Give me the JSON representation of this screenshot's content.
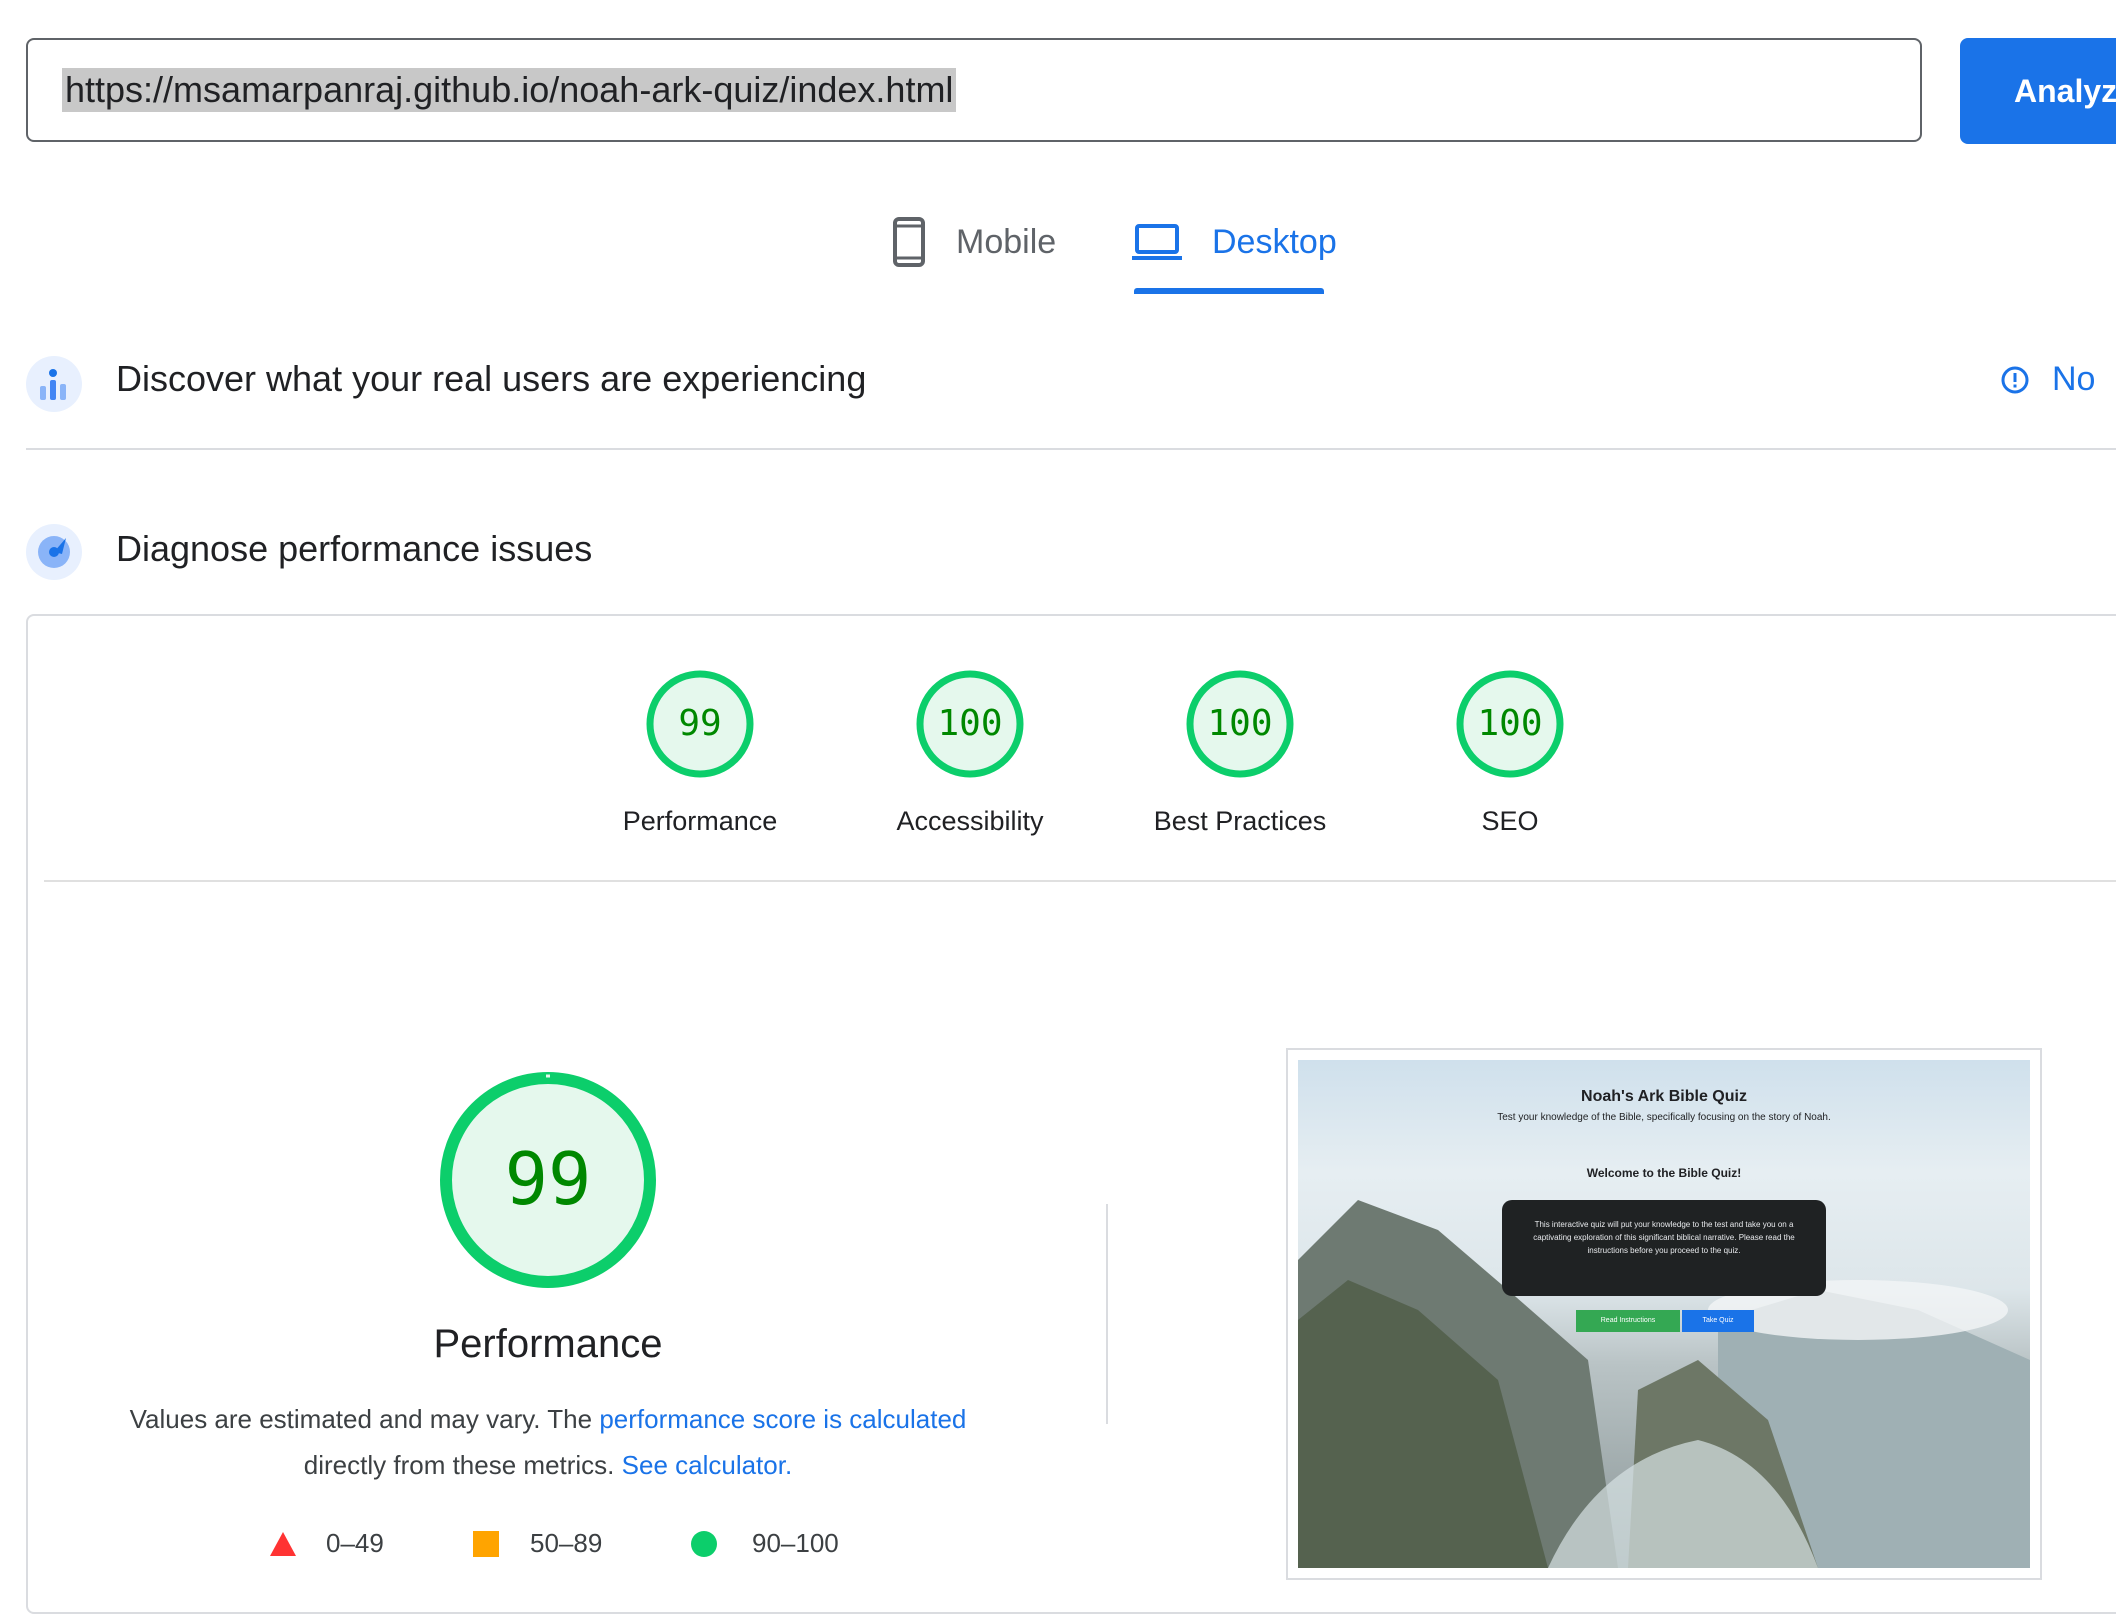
{
  "url_bar": {
    "value": "https://msamarpanraj.github.io/noah-ark-quiz/index.html",
    "analyze_label": "Analyze"
  },
  "device_tabs": {
    "mobile_label": "Mobile",
    "desktop_label": "Desktop",
    "selected": "Desktop"
  },
  "crux": {
    "title": "Discover what your real users are experiencing",
    "info_link": "No"
  },
  "diagnose": {
    "title": "Diagnose performance issues"
  },
  "categories": [
    {
      "label": "Performance",
      "score": "99"
    },
    {
      "label": "Accessibility",
      "score": "100"
    },
    {
      "label": "Best Practices",
      "score": "100"
    },
    {
      "label": "SEO",
      "score": "100"
    }
  ],
  "performance_detail": {
    "score": "99",
    "title": "Performance",
    "desc_prefix": "Values are estimated and may vary. The ",
    "desc_link1": "performance score is calculated",
    "desc_middle": " directly from these metrics. ",
    "desc_link2": "See calculator."
  },
  "legend": [
    {
      "range": "0–49",
      "shape": "triangle",
      "color": "#ff3333"
    },
    {
      "range": "50–89",
      "shape": "square",
      "color": "#ffa400"
    },
    {
      "range": "90–100",
      "shape": "circle",
      "color": "#0cce6b"
    }
  ],
  "screenshot": {
    "title": "Noah's Ark Bible Quiz",
    "subtitle": "Test your knowledge of the Bible, specifically focusing on the story of Noah.",
    "welcome": "Welcome to the Bible Quiz!",
    "body": "This interactive quiz will put your knowledge to the test and take you on a captivating exploration of this significant biblical narrative. Please read the instructions before you proceed to the quiz.",
    "button1": "Read Instructions",
    "button2": "Take Quiz"
  },
  "colors": {
    "accent": "#1a73e8",
    "pass": "#0cce6b",
    "pass_text": "#008800",
    "pass_fill": "#e5f8ed"
  }
}
